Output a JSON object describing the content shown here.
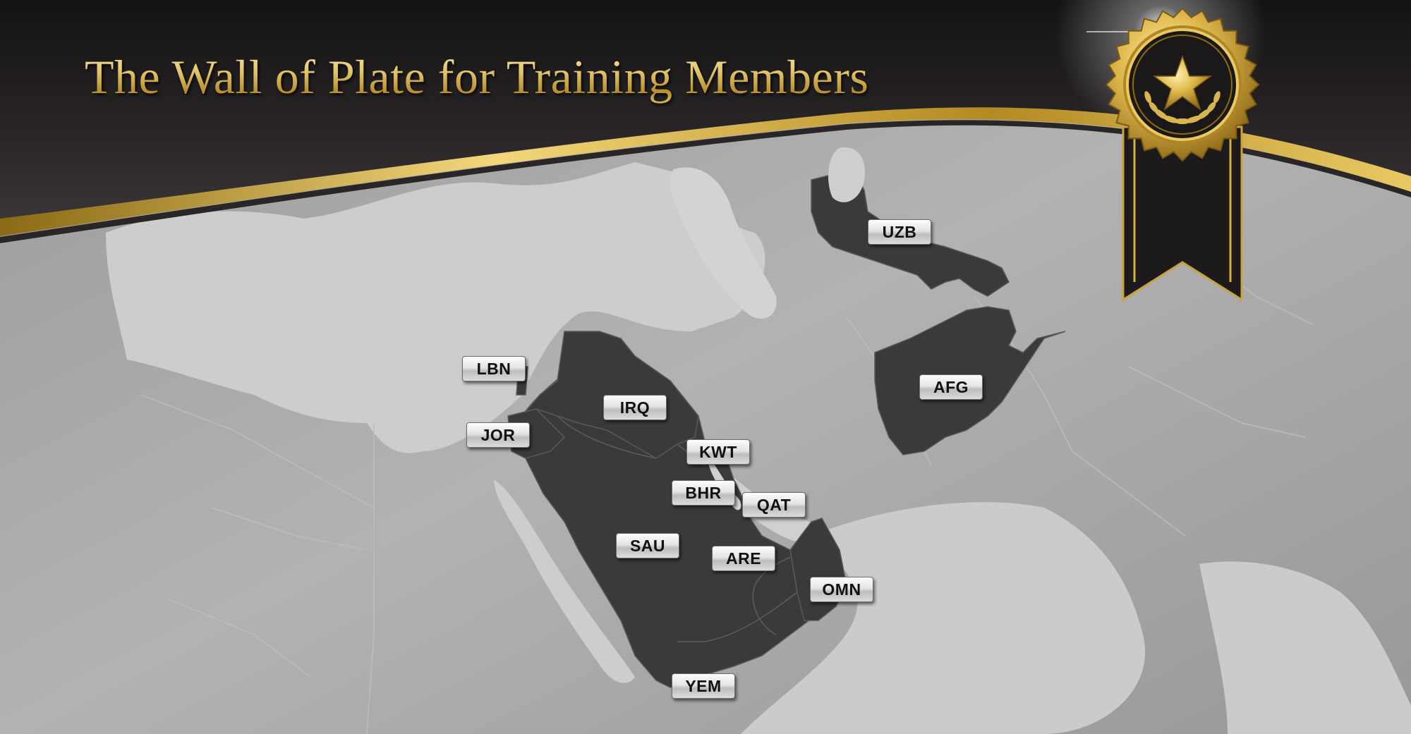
{
  "banner": {
    "title": "The Wall of  Plate for Training Members"
  },
  "colors": {
    "header": "#1f1b1c",
    "gold": "#d8b046",
    "member_land": "#3a3839",
    "other_land": "#a5a5a5",
    "water": "#cdcdcd"
  },
  "plates": [
    {
      "id": "LBN",
      "label": "LBN"
    },
    {
      "id": "JOR",
      "label": "JOR"
    },
    {
      "id": "IRQ",
      "label": "IRQ"
    },
    {
      "id": "KWT",
      "label": "KWT"
    },
    {
      "id": "BHR",
      "label": "BHR"
    },
    {
      "id": "QAT",
      "label": "QAT"
    },
    {
      "id": "SAU",
      "label": "SAU"
    },
    {
      "id": "ARE",
      "label": "ARE"
    },
    {
      "id": "OMN",
      "label": "OMN"
    },
    {
      "id": "YEM",
      "label": "YEM"
    },
    {
      "id": "UZB",
      "label": "UZB"
    },
    {
      "id": "AFG",
      "label": "AFG"
    }
  ],
  "badge": {
    "icon": "star-icon",
    "decor": "laurel-wreath-icon"
  }
}
